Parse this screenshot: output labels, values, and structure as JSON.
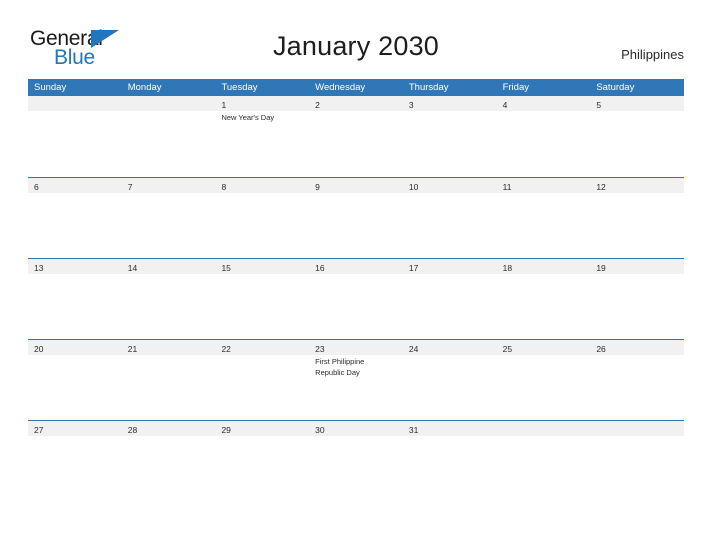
{
  "brand": {
    "name_part1": "General",
    "name_part2": "Blue",
    "triangle_icon": "triangle-flag-icon",
    "color_primary": "#2176bd",
    "color_text": "#1a1a1a"
  },
  "header": {
    "title": "January 2030",
    "country": "Philippines"
  },
  "calendar": {
    "header_bg": "#3077b8",
    "band_bg": "#f1f1f1",
    "separator_color": "#2e75b6",
    "weekdays": [
      "Sunday",
      "Monday",
      "Tuesday",
      "Wednesday",
      "Thursday",
      "Friday",
      "Saturday"
    ],
    "weeks": [
      [
        {
          "day": ""
        },
        {
          "day": ""
        },
        {
          "day": "1",
          "event": "New Year's Day"
        },
        {
          "day": "2"
        },
        {
          "day": "3"
        },
        {
          "day": "4"
        },
        {
          "day": "5"
        }
      ],
      [
        {
          "day": "6"
        },
        {
          "day": "7"
        },
        {
          "day": "8"
        },
        {
          "day": "9"
        },
        {
          "day": "10"
        },
        {
          "day": "11"
        },
        {
          "day": "12"
        }
      ],
      [
        {
          "day": "13"
        },
        {
          "day": "14"
        },
        {
          "day": "15"
        },
        {
          "day": "16"
        },
        {
          "day": "17"
        },
        {
          "day": "18"
        },
        {
          "day": "19"
        }
      ],
      [
        {
          "day": "20"
        },
        {
          "day": "21"
        },
        {
          "day": "22"
        },
        {
          "day": "23",
          "event": "First Philippine Republic Day"
        },
        {
          "day": "24"
        },
        {
          "day": "25"
        },
        {
          "day": "26"
        }
      ],
      [
        {
          "day": "27"
        },
        {
          "day": "28"
        },
        {
          "day": "29"
        },
        {
          "day": "30"
        },
        {
          "day": "31"
        },
        {
          "day": ""
        },
        {
          "day": ""
        }
      ]
    ]
  }
}
